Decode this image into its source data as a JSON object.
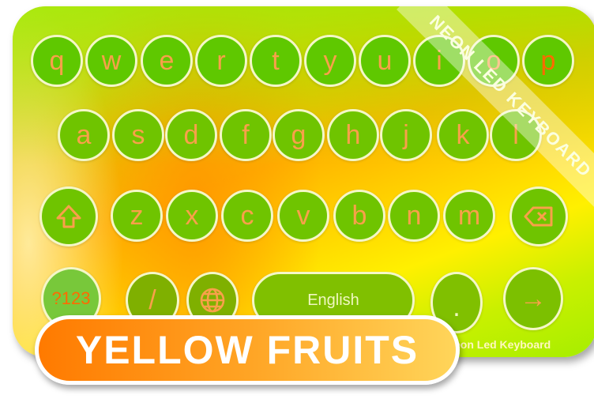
{
  "keyboard": {
    "row1": [
      "q",
      "w",
      "e",
      "r",
      "t",
      "y",
      "u",
      "i",
      "o",
      "p"
    ],
    "row2": [
      "a",
      "s",
      "d",
      "f",
      "g",
      "h",
      "j",
      "k",
      "l"
    ],
    "row3": [
      "z",
      "x",
      "c",
      "v",
      "b",
      "n",
      "m"
    ],
    "symbols_label": "?123",
    "slash_label": "/",
    "space_label": "English",
    "period_label": ".",
    "enter_label": "→"
  },
  "ribbon": "NEON LED KEYBOARD",
  "brand": "eon Led Keyboard",
  "title": "YELLOW FRUITS",
  "colors": {
    "key": "#6fc400",
    "key_text": "#f9a04a",
    "title_start": "#ff7a00",
    "title_end": "#ffd55a"
  }
}
